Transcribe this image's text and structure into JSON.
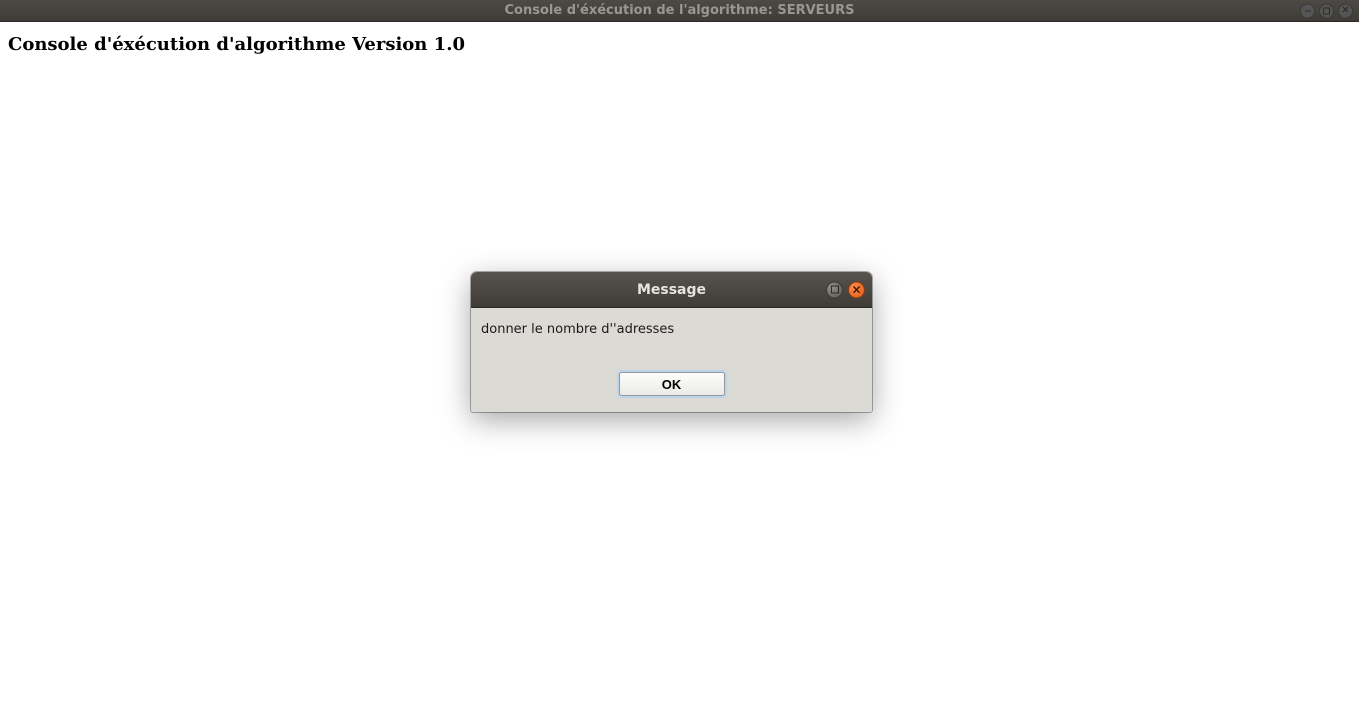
{
  "main_window": {
    "title": "Console d'éxécution de l'algorithme: SERVEURS"
  },
  "console": {
    "heading": "Console d'éxécution d'algorithme Version 1.0"
  },
  "dialog": {
    "title": "Message",
    "message": "donner le nombre d''adresses",
    "ok_label": "OK"
  }
}
